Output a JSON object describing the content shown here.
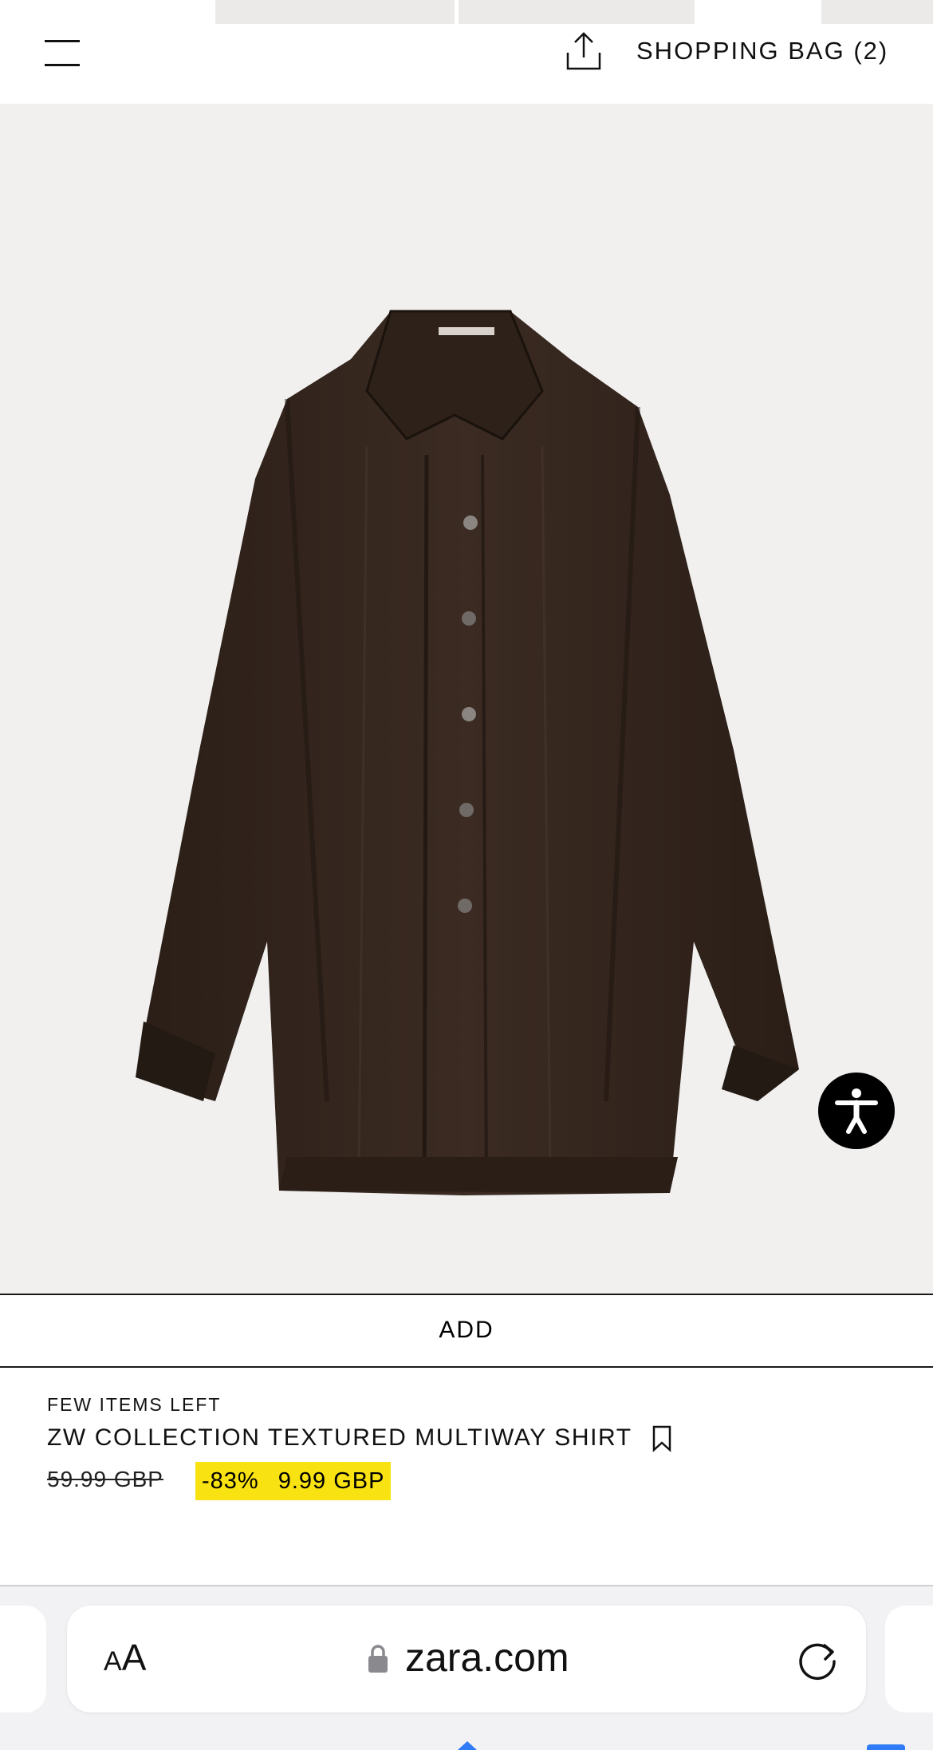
{
  "header": {
    "menu_icon": "hamburger-menu-icon",
    "share_icon": "share-icon",
    "shopping_bag_label": "SHOPPING BAG (2)"
  },
  "product": {
    "image_alt": "dark brown textured long-sleeve button-up shirt",
    "add_label": "ADD",
    "stock_notice": "FEW ITEMS LEFT",
    "name": "ZW COLLECTION TEXTURED MULTIWAY SHIRT",
    "original_price": "59.99 GBP",
    "discount": "-83%",
    "sale_price": "9.99 GBP",
    "sale_highlight_color": "#f8e211",
    "bookmark_icon": "bookmark-icon"
  },
  "accessibility_button": {
    "icon": "accessibility-icon"
  },
  "browser": {
    "text_size_label_small": "A",
    "text_size_label_large": "A",
    "url": "zara.com",
    "lock_icon": "lock-icon",
    "reload_icon": "reload-icon"
  }
}
